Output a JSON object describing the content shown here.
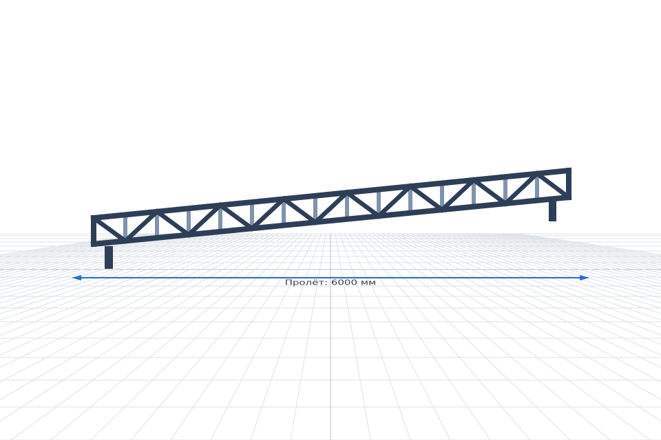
{
  "viewport": {
    "name": "3d-truss-viewport",
    "background": "#ffffff"
  },
  "model": {
    "type": "truss",
    "panels": 15,
    "chord_color": "#2e3e57",
    "diagonal_color": "#2e3e57",
    "vertical_color": "#8093ad",
    "support_color": "#2e3e57"
  },
  "dimension": {
    "label": "Пролёт: 6000 мм",
    "line_color": "#2a6fd6"
  },
  "grid": {
    "line_color": "#dde1e7",
    "axis_color": "#b9bfc8"
  }
}
